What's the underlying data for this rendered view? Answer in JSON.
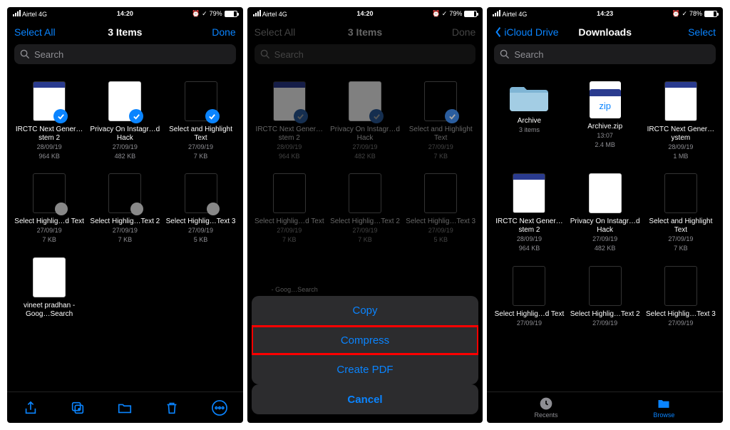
{
  "status": {
    "carrier": "Airtel",
    "net": "4G",
    "batt": "79%",
    "t1": "14:20",
    "t2": "14:20",
    "t3": "14:23",
    "batt3": "78%"
  },
  "nav": {
    "selectAll": "Select All",
    "done": "Done",
    "items3": "3 Items",
    "back": "iCloud Drive",
    "downloads": "Downloads",
    "select": "Select"
  },
  "search": {
    "placeholder": "Search"
  },
  "files": {
    "irctc": {
      "name": "IRCTC Next Gener…stem 2",
      "date": "28/09/19",
      "size": "964 KB"
    },
    "priv": {
      "name": "Privacy On Instagr…d Hack",
      "date": "27/09/19",
      "size": "482 KB"
    },
    "sel": {
      "name": "Select and Highlight Text",
      "date": "27/09/19",
      "size": "7 KB"
    },
    "selhl": {
      "name": "Select Highlig…d Text",
      "date": "27/09/19",
      "size": "7 KB"
    },
    "selhl2": {
      "name": "Select Highlig…Text 2",
      "date": "27/09/19",
      "size": "7 KB"
    },
    "selhl3": {
      "name": "Select Highlig…Text 3",
      "date": "27/09/19",
      "size": "5 KB"
    },
    "vineet": {
      "name": "vineet pradhan - Goog…Search"
    },
    "archive": {
      "name": "Archive",
      "meta": "3 items"
    },
    "zip": {
      "name": "Archive.zip",
      "date": "13:07",
      "size": "2.4 MB",
      "label": "zip"
    },
    "irctc3": {
      "name": "IRCTC Next Gener…ystem",
      "date": "28/09/19",
      "size": "1 MB"
    },
    "irctc3b": {
      "name": "IRCTC Next Gener…stem 2",
      "date": "28/09/19",
      "size": "964 KB"
    },
    "trunc": "- Goog…Search"
  },
  "sheet": {
    "copy": "Copy",
    "compress": "Compress",
    "pdf": "Create PDF",
    "cancel": "Cancel"
  },
  "tabs": {
    "recents": "Recents",
    "browse": "Browse"
  }
}
